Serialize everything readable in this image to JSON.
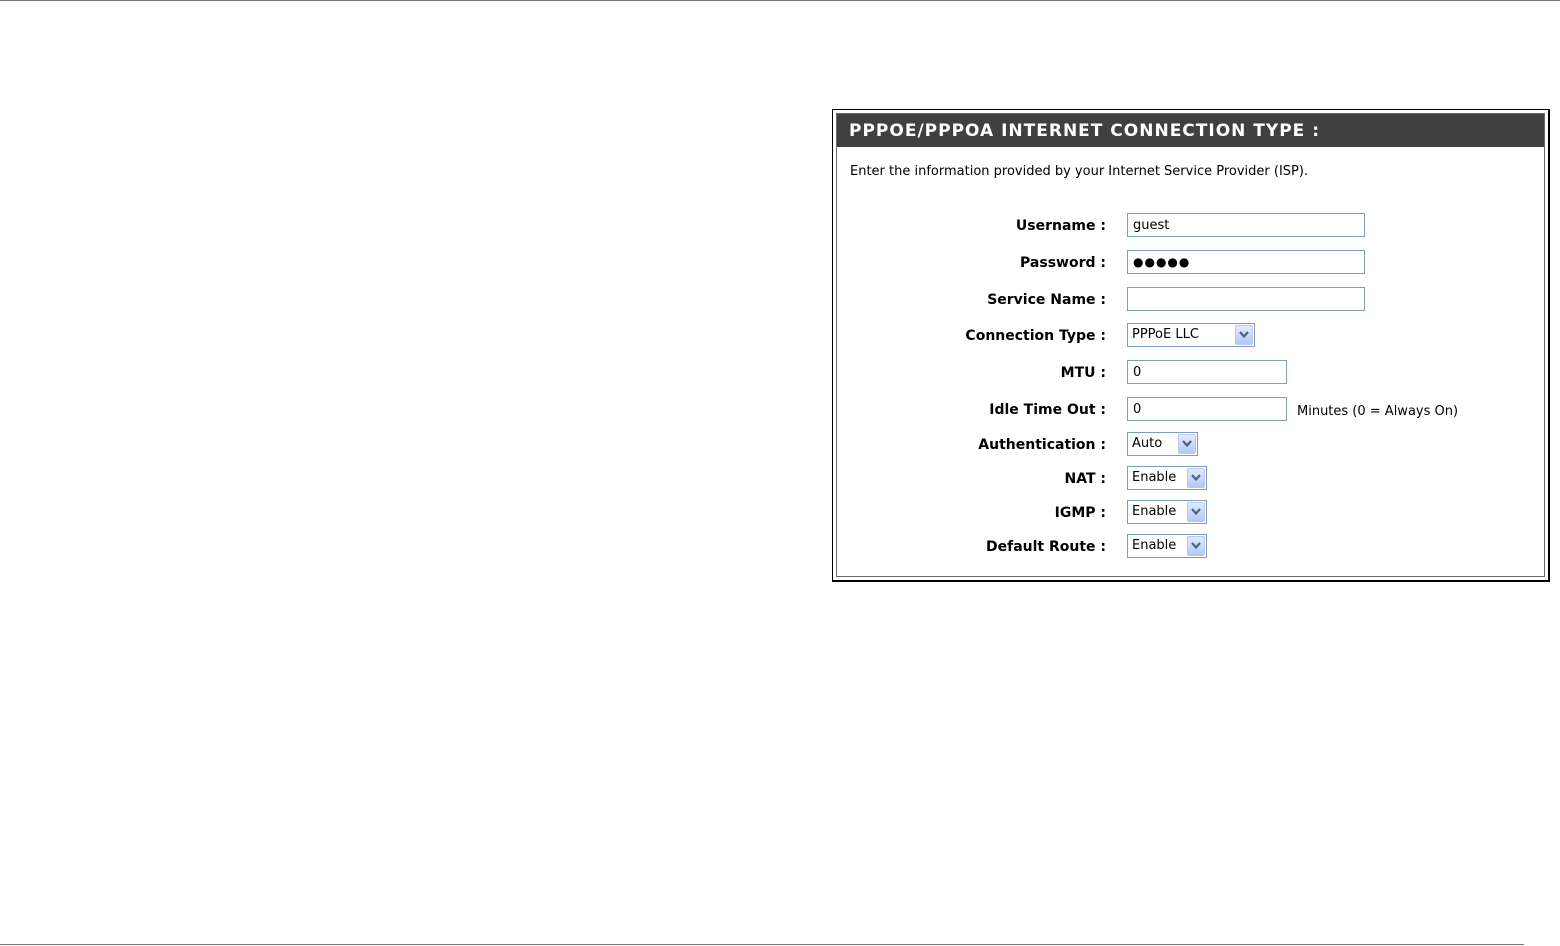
{
  "panel": {
    "title": "PPPOE/PPPOA INTERNET CONNECTION TYPE :",
    "intro": "Enter the information provided by your Internet Service Provider (ISP)."
  },
  "fields": {
    "username": {
      "label": "Username :",
      "value": "guest"
    },
    "password": {
      "label": "Password :",
      "masked_value": "●●●●●"
    },
    "service_name": {
      "label": "Service Name :",
      "value": ""
    },
    "connection_type": {
      "label": "Connection Type :",
      "selected": "PPPoE LLC"
    },
    "mtu": {
      "label": "MTU :",
      "value": "0"
    },
    "idle_time_out": {
      "label": "Idle Time Out :",
      "value": "0",
      "hint": "Minutes (0 = Always On)"
    },
    "authentication": {
      "label": "Authentication :",
      "selected": "Auto"
    },
    "nat": {
      "label": "NAT :",
      "selected": "Enable"
    },
    "igmp": {
      "label": "IGMP :",
      "selected": "Enable"
    },
    "default_route": {
      "label": "Default Route :",
      "selected": "Enable"
    }
  },
  "icons": {
    "dropdown": "chevron-down-icon"
  },
  "colors": {
    "header_bg": "#404040",
    "header_text": "#ffffff",
    "field_border": "#7f9db9",
    "dropdown_button": "#b4c8f6"
  }
}
